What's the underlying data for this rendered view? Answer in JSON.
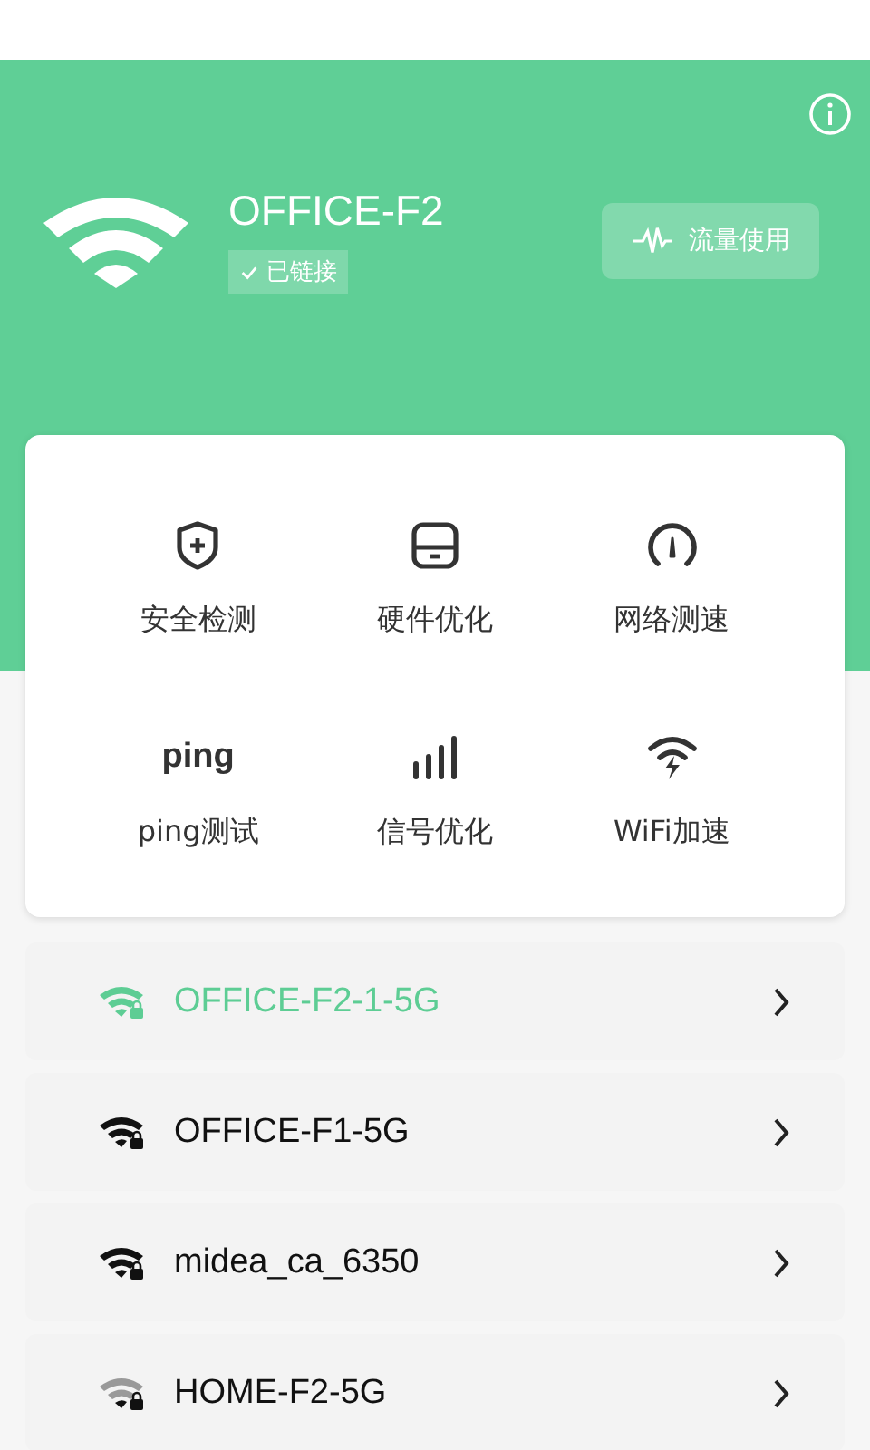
{
  "header": {
    "network_name": "OFFICE-F2",
    "status": "已链接",
    "traffic_button": "流量使用"
  },
  "tools": [
    {
      "label": "安全检测"
    },
    {
      "label": "硬件优化"
    },
    {
      "label": "网络测速"
    },
    {
      "label": "ping测试",
      "icon_text": "ping"
    },
    {
      "label": "信号优化"
    },
    {
      "label": "WiFi加速"
    }
  ],
  "networks": [
    {
      "name": "OFFICE-F2-1-5G",
      "selected": true
    },
    {
      "name": "OFFICE-F1-5G",
      "selected": false
    },
    {
      "name": "midea_ca_6350",
      "selected": false
    },
    {
      "name": "HOME-F2-5G",
      "selected": false
    }
  ]
}
